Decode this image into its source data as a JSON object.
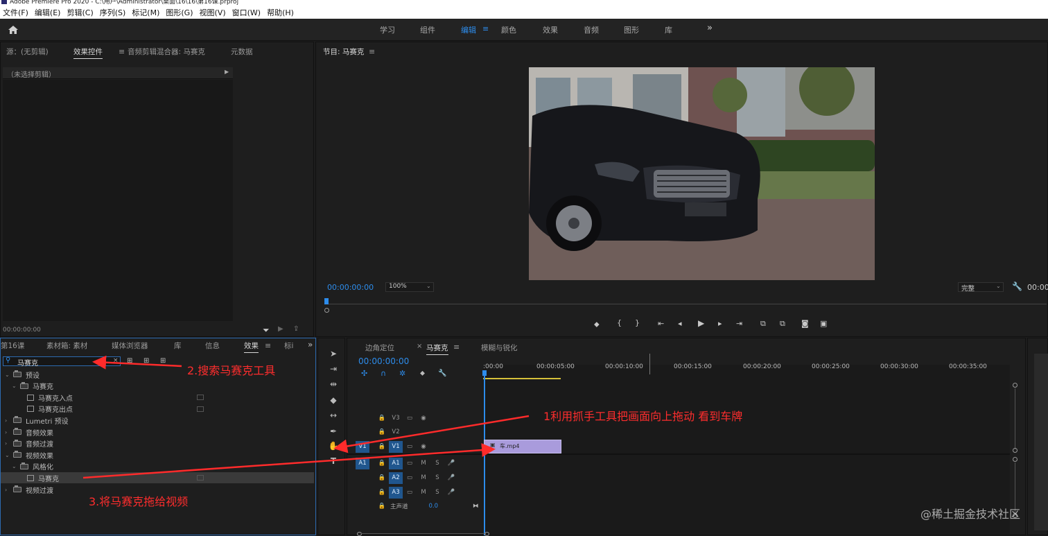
{
  "window": {
    "title": "Adobe Premiere Pro 2020 - C:\\用户\\Administrator\\桌面\\16\\16\\第16课.prproj"
  },
  "menu": [
    "文件(F)",
    "编辑(E)",
    "剪辑(C)",
    "序列(S)",
    "标记(M)",
    "图形(G)",
    "视图(V)",
    "窗口(W)",
    "帮助(H)"
  ],
  "workspaces": {
    "items": [
      "学习",
      "组件",
      "编辑",
      "颜色",
      "效果",
      "音频",
      "图形",
      "库"
    ],
    "active": "编辑",
    "overflow": "»"
  },
  "source_panel": {
    "tabs": [
      "源：(无剪辑)",
      "效果控件",
      "音频剪辑混合器: 马赛克",
      "元数据"
    ],
    "active_tab": "效果控件",
    "no_clip": "（未选择剪辑）",
    "timecode": "00:00:00:00"
  },
  "program_panel": {
    "title": "节目: 马赛克",
    "timecode": "00:00:00:00",
    "zoom": "100%",
    "quality": "完整",
    "timecode_right": "00:00"
  },
  "project_panel": {
    "tabs": [
      "第16课",
      "素材箱: 素材",
      "媒体浏览器",
      "库",
      "信息",
      "效果",
      "标i"
    ],
    "active_tab": "效果",
    "search_value": "马赛克",
    "tree": [
      {
        "label": "预设",
        "level": 0,
        "kind": "folder",
        "open": true
      },
      {
        "label": "马赛克",
        "level": 1,
        "kind": "folder",
        "open": true
      },
      {
        "label": "马赛克入点",
        "level": 2,
        "kind": "preset"
      },
      {
        "label": "马赛克出点",
        "level": 2,
        "kind": "preset"
      },
      {
        "label": "Lumetri 预设",
        "level": 0,
        "kind": "folder",
        "open": false
      },
      {
        "label": "音频效果",
        "level": 0,
        "kind": "folder",
        "open": false
      },
      {
        "label": "音频过渡",
        "level": 0,
        "kind": "folder",
        "open": false
      },
      {
        "label": "视频效果",
        "level": 0,
        "kind": "folder",
        "open": true
      },
      {
        "label": "风格化",
        "level": 1,
        "kind": "folder",
        "open": true
      },
      {
        "label": "马赛克",
        "level": 2,
        "kind": "effect",
        "selected": true
      },
      {
        "label": "视频过渡",
        "level": 0,
        "kind": "folder",
        "open": false
      }
    ]
  },
  "timeline": {
    "tabs": [
      "边角定位",
      "马赛克",
      "模糊与锐化"
    ],
    "active_tab": "马赛克",
    "timecode": "00:00:00:00",
    "ruler": [
      ":00:00",
      "00:00:05:00",
      "00:00:10:00",
      "00:00:15:00",
      "00:00:20:00",
      "00:00:25:00",
      "00:00:30:00",
      "00:00:35:00"
    ],
    "video_tracks": [
      "V3",
      "V2",
      "V1"
    ],
    "audio_tracks": [
      "A1",
      "A2",
      "A3"
    ],
    "source_patch_v": "V1",
    "source_patch_a": "A1",
    "mute_label": "M",
    "solo_label": "S",
    "master": {
      "label": "主声道",
      "value": "0.0"
    },
    "clip": {
      "name": "车.mp4",
      "color": "#a99bdc"
    }
  },
  "annotations": {
    "step1": "1利用抓手工具把画面向上拖动 看到车牌",
    "step2": "2.搜索马赛克工具",
    "step3": "3.将马赛克拖给视频",
    "color": "#ff2b2b"
  },
  "watermark": "@稀土掘金技术社区",
  "colors": {
    "accent": "#2d8ceb",
    "panel": "#1e1e1e",
    "clip": "#a99bdc"
  }
}
